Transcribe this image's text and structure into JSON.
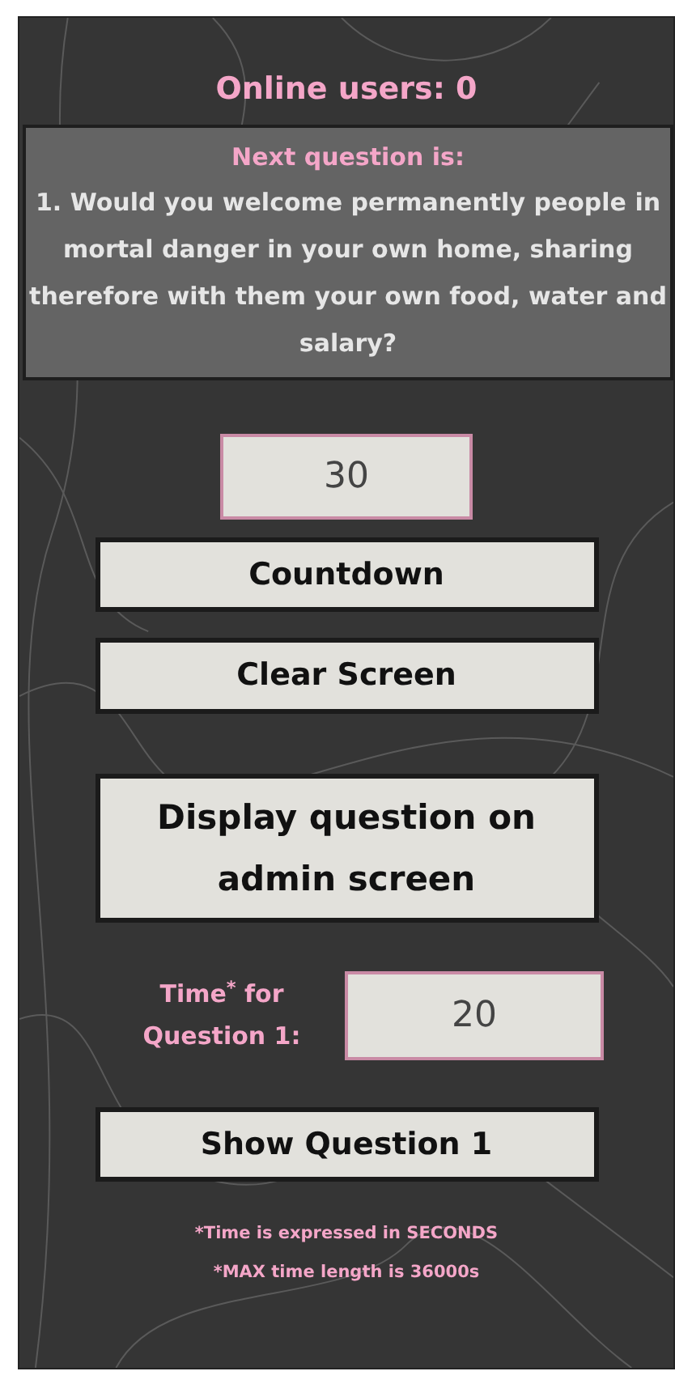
{
  "header": {
    "title": "Online users: 0"
  },
  "next_question": {
    "heading": "Next question is:",
    "text": "1. Would you welcome permanently people in mortal danger in your own home, sharing therefore with them your own food, water and salary?"
  },
  "countdown_field": {
    "value": "30"
  },
  "buttons": [
    {
      "label": "Countdown",
      "kind": "single"
    },
    {
      "label": "Clear Screen",
      "kind": "single"
    },
    {
      "label": "Display question on admin screen",
      "kind": "tall"
    }
  ],
  "time_field": {
    "label": "Time$^{*}$ for Question 1:",
    "value": "20"
  },
  "show_button": {
    "label": "Show Question 1"
  },
  "notes": [
    "*Time is expressed in SECONDS",
    "*MAX time length is 36000s"
  ]
}
